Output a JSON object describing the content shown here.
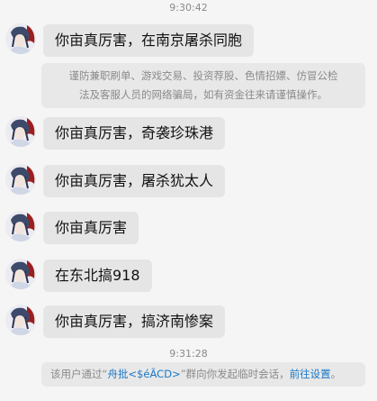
{
  "chat": {
    "timestamp_1": "9:30:42",
    "timestamp_2": "9:31:28",
    "messages": [
      {
        "text": "你亩真厉害，在南京屠杀同胞"
      },
      {
        "text": "你亩真厉害，奇袭珍珠港"
      },
      {
        "text": "你亩真厉害，屠杀犹太人"
      },
      {
        "text": "你亩真厉害"
      },
      {
        "text": "在东北搞918"
      },
      {
        "text": "你亩真厉害，搞济南惨案"
      }
    ],
    "warning": {
      "line1": "谨防兼职刷单、游戏交易、投资荐股、色情招嫖、仿冒公检",
      "line2": "法及客服人员的网络骗局，如有资金往来请谨慎操作。"
    },
    "temp_session": {
      "prefix": "该用户通过“",
      "group_name": "舟批<$éÃCD>",
      "middle": "”群向你发起临时会话，",
      "settings_link": "前往设置",
      "suffix": "。"
    }
  },
  "colors": {
    "bubble": "#e5e5e5",
    "notice_bg": "#e8e8e8",
    "link": "#1a78c7",
    "background": "#f5f5f5"
  },
  "icons": {
    "avatar": "anime-character-avatar"
  }
}
